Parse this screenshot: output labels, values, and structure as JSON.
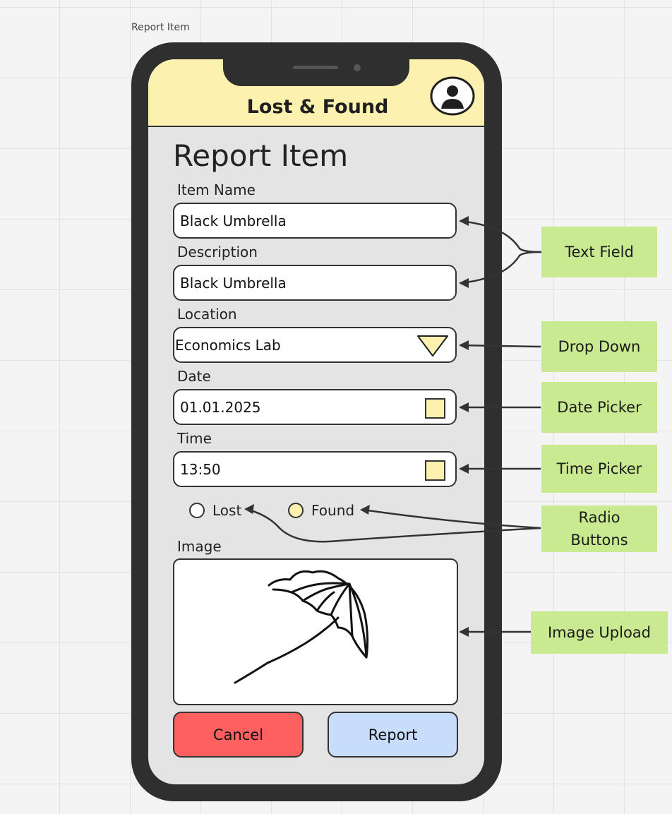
{
  "frame": {
    "label": "Report Item"
  },
  "app": {
    "title": "Lost & Found"
  },
  "page": {
    "title": "Report Item"
  },
  "form": {
    "item_name": {
      "label": "Item Name",
      "value": "Black Umbrella"
    },
    "description": {
      "label": "Description",
      "value": "Black Umbrella"
    },
    "location": {
      "label": "Location",
      "value": "Economics Lab"
    },
    "date": {
      "label": "Date",
      "value": "01.01.2025"
    },
    "time": {
      "label": "Time",
      "value": "13:50"
    },
    "status": {
      "options": [
        {
          "label": "Lost",
          "selected": false
        },
        {
          "label": "Found",
          "selected": true
        }
      ]
    },
    "image": {
      "label": "Image",
      "icon": "umbrella-icon"
    }
  },
  "buttons": {
    "cancel": "Cancel",
    "report": "Report"
  },
  "annotations": {
    "text_field": "Text Field",
    "drop_down": "Drop Down",
    "date_picker": "Date Picker",
    "time_picker": "Time Picker",
    "radio_buttons_line1": "Radio",
    "radio_buttons_line2": "Buttons",
    "image_upload": "Image Upload"
  },
  "colors": {
    "header": "#fdf1b0",
    "accent_yellow": "#fdf1b0",
    "cancel": "#fe6060",
    "report": "#c8dcfb",
    "annotation": "#c9ea91",
    "phone": "#2f2f2f"
  }
}
